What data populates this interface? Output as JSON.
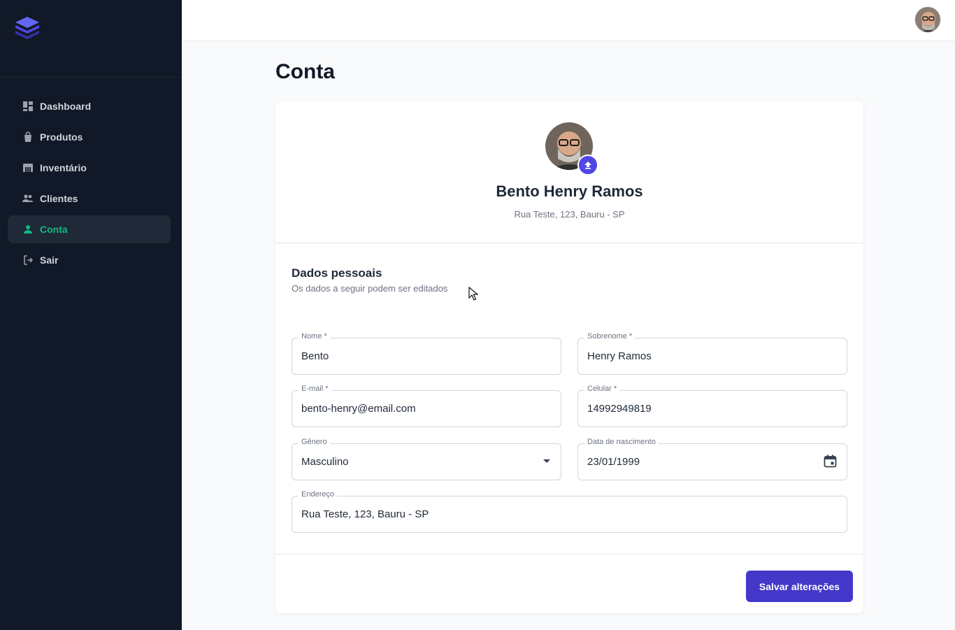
{
  "sidebar": {
    "items": [
      {
        "label": "Dashboard",
        "icon": "dashboard-icon"
      },
      {
        "label": "Produtos",
        "icon": "shopping-bag-icon"
      },
      {
        "label": "Inventário",
        "icon": "warehouse-icon"
      },
      {
        "label": "Clientes",
        "icon": "people-icon"
      },
      {
        "label": "Conta",
        "icon": "person-icon",
        "active": true
      },
      {
        "label": "Sair",
        "icon": "logout-icon"
      }
    ]
  },
  "page": {
    "title": "Conta"
  },
  "profile": {
    "name": "Bento Henry Ramos",
    "address": "Rua Teste, 123, Bauru - SP"
  },
  "form": {
    "title": "Dados pessoais",
    "subtitle": "Os dados a seguir podem ser editados",
    "fields": {
      "nome": {
        "label": "Nome *",
        "value": "Bento"
      },
      "sobrenome": {
        "label": "Sobrenome *",
        "value": "Henry Ramos"
      },
      "email": {
        "label": "E-mail *",
        "value": "bento-henry@email.com"
      },
      "celular": {
        "label": "Celular *",
        "value": "14992949819"
      },
      "genero": {
        "label": "Gênero",
        "value": "Masculino"
      },
      "nascimento": {
        "label": "Data de nascimento",
        "value": "23/01/1999"
      },
      "endereco": {
        "label": "Endereço",
        "value": "Rua Teste, 123, Bauru - SP"
      }
    },
    "save_label": "Salvar alterações"
  },
  "colors": {
    "sidebar_bg": "#111827",
    "active": "#10b981",
    "primary": "#4338ca"
  }
}
